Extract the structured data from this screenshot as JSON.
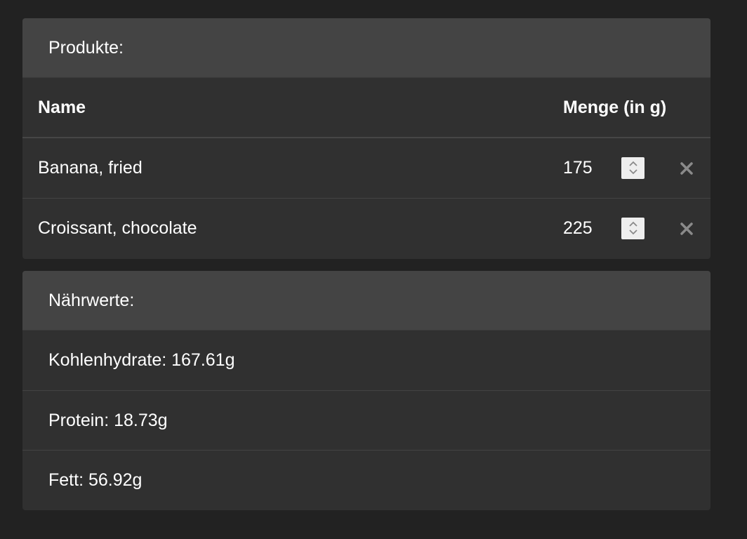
{
  "products_panel": {
    "heading": "Produkte:",
    "columns": {
      "name": "Name",
      "amount": "Menge (in g)"
    },
    "rows": [
      {
        "name": "Banana, fried",
        "amount": "175"
      },
      {
        "name": "Croissant, chocolate",
        "amount": "225"
      }
    ],
    "stepper_icon": "up-down-chevron-icon",
    "remove_icon": "close-icon"
  },
  "nutrients_panel": {
    "heading": "Nährwerte:",
    "items": [
      {
        "label": "Kohlenhydrate: 167.61g"
      },
      {
        "label": "Protein: 18.73g"
      },
      {
        "label": "Fett: 56.92g"
      }
    ]
  },
  "colors": {
    "page_bg": "#222222",
    "panel_bg": "#303030",
    "heading_bg": "#444444",
    "text": "#ffffff",
    "icon_gray": "#8a8a8a"
  }
}
